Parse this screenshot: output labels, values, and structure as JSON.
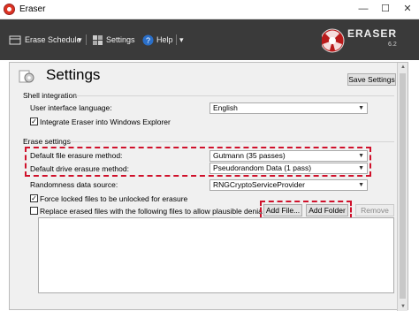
{
  "window": {
    "title": "Eraser",
    "minimize": "—",
    "maximize": "☐",
    "close": "✕"
  },
  "toolbar": {
    "erase_schedule": "Erase Schedule",
    "settings": "Settings",
    "help": "Help",
    "dropdown_arrow": "▾"
  },
  "logo": {
    "text": "ERASER",
    "version": "6.2"
  },
  "settings": {
    "title": "Settings",
    "save_button": "Save Settings",
    "shell_integration": {
      "group_label": "Shell integration",
      "language_label": "User interface language:",
      "language_value": "English",
      "integrate_label": "Integrate Eraser into Windows Explorer",
      "integrate_checked": true
    },
    "erase_settings": {
      "group_label": "Erase settings",
      "file_method_label": "Default file erasure method:",
      "file_method_value": "Gutmann (35 passes)",
      "drive_method_label": "Default drive erasure method:",
      "drive_method_value": "Pseudorandom Data (1 pass)",
      "randomness_label": "Randomness data source:",
      "randomness_value": "RNGCryptoServiceProvider",
      "force_unlock_label": "Force locked files to be unlocked for erasure",
      "force_unlock_checked": true,
      "replace_label": "Replace erased files with the following files to allow plausible deniability",
      "replace_checked": false,
      "add_file_button": "Add File...",
      "add_folder_button": "Add Folder",
      "remove_button": "Remove"
    }
  },
  "colors": {
    "highlight": "#d0112b",
    "toolbar": "#3a3a3a"
  }
}
